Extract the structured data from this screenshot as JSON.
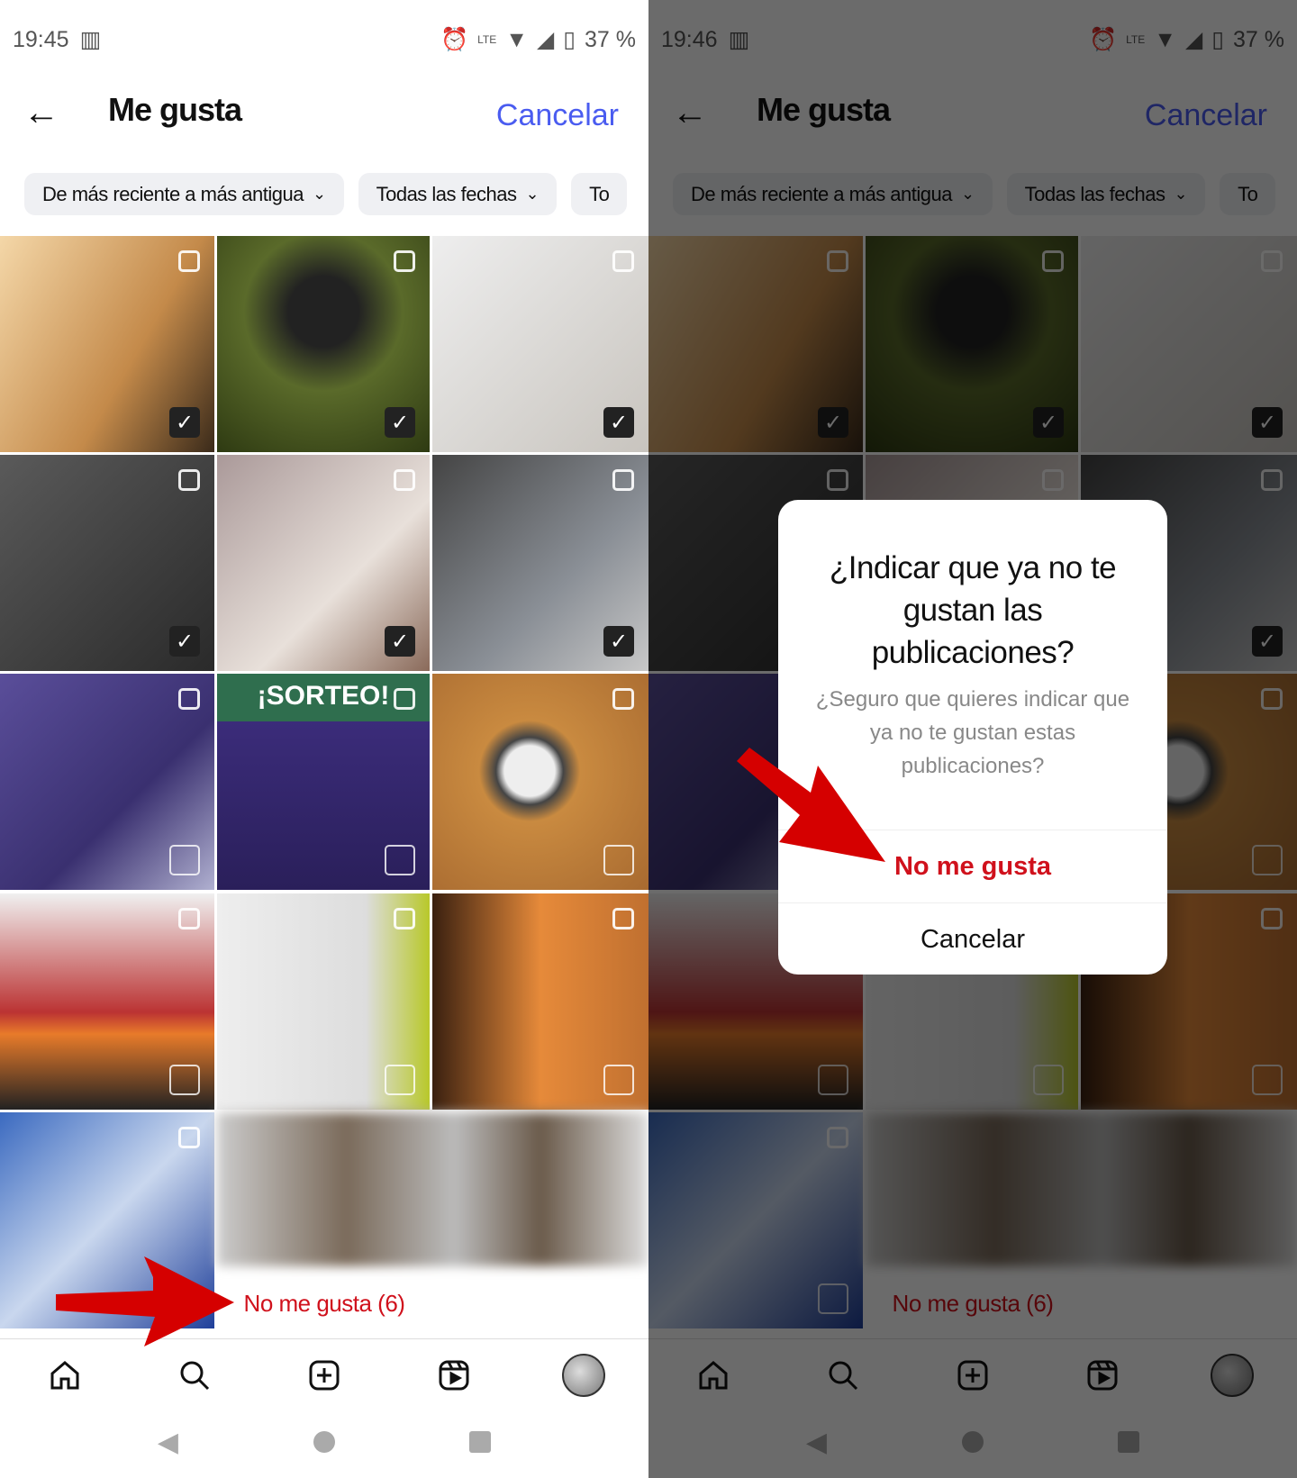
{
  "panels": [
    {
      "status": {
        "time": "19:45",
        "battery": "37 %"
      }
    },
    {
      "status": {
        "time": "19:46",
        "battery": "37 %"
      }
    }
  ],
  "header": {
    "title": "Me gusta",
    "cancel_label": "Cancelar"
  },
  "filters": [
    {
      "label": "De más reciente a más antigua"
    },
    {
      "label": "Todas las fechas"
    },
    {
      "label": "To"
    }
  ],
  "grid": {
    "tiles": [
      {
        "checked": true
      },
      {
        "checked": true
      },
      {
        "checked": true
      },
      {
        "checked": true
      },
      {
        "checked": true
      },
      {
        "checked": true
      },
      {
        "checked": false
      },
      {
        "checked": false,
        "overlay_text": "¡SORTEO!"
      },
      {
        "checked": false
      },
      {
        "checked": false
      },
      {
        "checked": false
      },
      {
        "checked": false
      },
      {
        "checked": false
      }
    ]
  },
  "unlike_bar": {
    "label": "No me gusta (6)"
  },
  "nav": [
    "home-icon",
    "search-icon",
    "create-icon",
    "reels-icon",
    "profile-avatar"
  ],
  "dialog": {
    "title": "¿Indicar que ya no te gustan las publicaciones?",
    "message": "¿Seguro que quieres indicar que ya no te gustan estas publicaciones?",
    "confirm_label": "No me gusta",
    "cancel_label": "Cancelar"
  },
  "colors": {
    "accent": "#4a5cf0",
    "danger": "#d0111c",
    "annotation_arrow": "#d50000"
  }
}
